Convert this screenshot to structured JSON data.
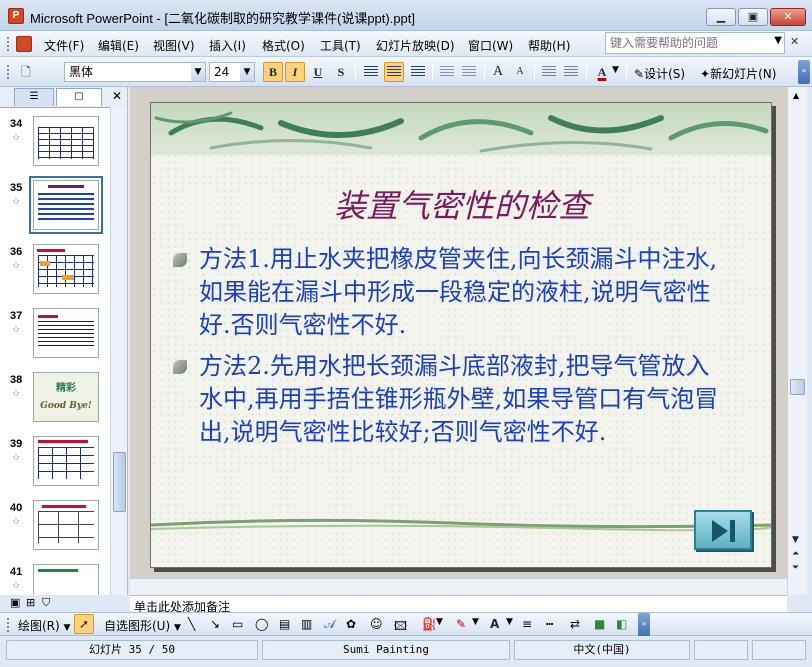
{
  "window": {
    "title": "Microsoft PowerPoint - [二氧化碳制取的研究教学课件(说课ppt).ppt]",
    "app_icon_label": "P"
  },
  "menu": {
    "items": [
      "文件(F)",
      "编辑(E)",
      "视图(V)",
      "插入(I)",
      "格式(O)",
      "工具(T)",
      "幻灯片放映(D)",
      "窗口(W)",
      "帮助(H)"
    ],
    "help_placeholder": "键入需要帮助的问题"
  },
  "toolbar": {
    "font_name": "黑体",
    "font_size": "24",
    "bold_label": "B",
    "italic_label": "I",
    "underline_label": "U",
    "shadow_label": "S",
    "increase_font_label": "A",
    "decrease_font_label": "A",
    "font_color_label": "A",
    "design_label": "设计(S)",
    "new_slide_label": "新幻灯片(N)"
  },
  "slides_pane": {
    "thumbnails": [
      {
        "number": "34"
      },
      {
        "number": "35"
      },
      {
        "number": "36"
      },
      {
        "number": "37"
      },
      {
        "number": "38",
        "thumb_text_top": "精彩",
        "thumb_text_bottom": "Good Bye!"
      },
      {
        "number": "39"
      },
      {
        "number": "40"
      },
      {
        "number": "41"
      }
    ]
  },
  "slide": {
    "title": "装置气密性的检查",
    "bullets": [
      "方法1.用止水夹把橡皮管夹住,向长颈漏斗中注水,如果能在漏斗中形成一段稳定的液柱,说明气密性好.否则气密性不好.",
      "方法2.先用水把长颈漏斗底部液封,把导气管放入水中,再用手捂住锥形瓶外壁,如果导管口有气泡冒出,说明气密性比较好;否则气密性不好."
    ]
  },
  "notes": {
    "placeholder": "单击此处添加备注"
  },
  "drawing_toolbar": {
    "draw_label": "绘图(R)",
    "autoshapes_label": "自选图形(U)"
  },
  "status": {
    "slide_position": "幻灯片 35 / 50",
    "design_template": "Sumi Painting",
    "language": "中文(中国)"
  }
}
